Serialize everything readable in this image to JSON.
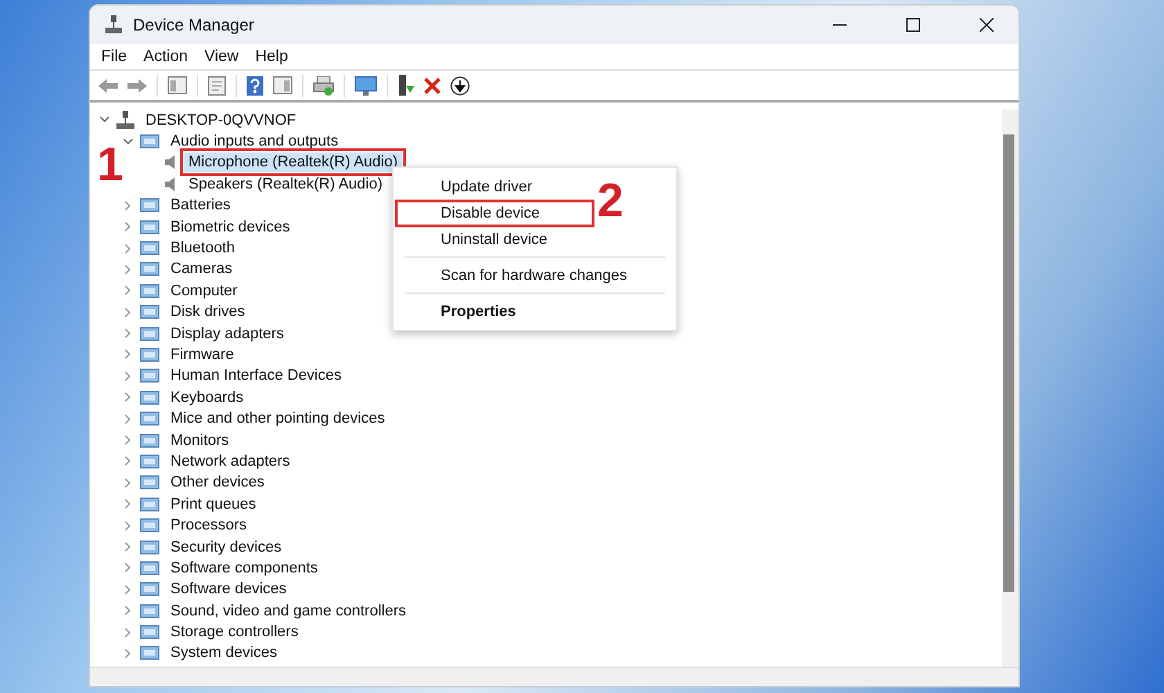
{
  "window": {
    "title": "Device Manager"
  },
  "menu": [
    "File",
    "Action",
    "View",
    "Help"
  ],
  "tree": {
    "label": "DESKTOP-0QVVNOF",
    "expanded": true,
    "children": [
      {
        "label": "Audio inputs and outputs",
        "expanded": true,
        "children": [
          {
            "label": "Microphone (Realtek(R) Audio)",
            "selected": true,
            "annotated": true
          },
          {
            "label": "Speakers (Realtek(R) Audio)",
            "selected": false,
            "annotated": false
          }
        ]
      },
      {
        "label": "Batteries",
        "expanded": false
      },
      {
        "label": "Biometric devices",
        "expanded": false
      },
      {
        "label": "Bluetooth",
        "expanded": false
      },
      {
        "label": "Cameras",
        "expanded": false
      },
      {
        "label": "Computer",
        "expanded": false
      },
      {
        "label": "Disk drives",
        "expanded": false
      },
      {
        "label": "Display adapters",
        "expanded": false
      },
      {
        "label": "Firmware",
        "expanded": false
      },
      {
        "label": "Human Interface Devices",
        "expanded": false
      },
      {
        "label": "Keyboards",
        "expanded": false
      },
      {
        "label": "Mice and other pointing devices",
        "expanded": false
      },
      {
        "label": "Monitors",
        "expanded": false
      },
      {
        "label": "Network adapters",
        "expanded": false
      },
      {
        "label": "Other devices",
        "expanded": false
      },
      {
        "label": "Print queues",
        "expanded": false
      },
      {
        "label": "Processors",
        "expanded": false
      },
      {
        "label": "Security devices",
        "expanded": false
      },
      {
        "label": "Software components",
        "expanded": false
      },
      {
        "label": "Software devices",
        "expanded": false
      },
      {
        "label": "Sound, video and game controllers",
        "expanded": false
      },
      {
        "label": "Storage controllers",
        "expanded": false
      },
      {
        "label": "System devices",
        "expanded": false
      }
    ]
  },
  "context_menu": [
    {
      "kind": "item",
      "label": "Update driver",
      "bold": false,
      "annotated": false
    },
    {
      "kind": "item",
      "label": "Disable device",
      "bold": false,
      "annotated": true
    },
    {
      "kind": "item",
      "label": "Uninstall device",
      "bold": false,
      "annotated": false
    },
    {
      "kind": "separator"
    },
    {
      "kind": "item",
      "label": "Scan for hardware changes",
      "bold": false,
      "annotated": false
    },
    {
      "kind": "separator"
    },
    {
      "kind": "item",
      "label": "Properties",
      "bold": true,
      "annotated": false
    }
  ],
  "annotations": [
    "1",
    "2"
  ]
}
